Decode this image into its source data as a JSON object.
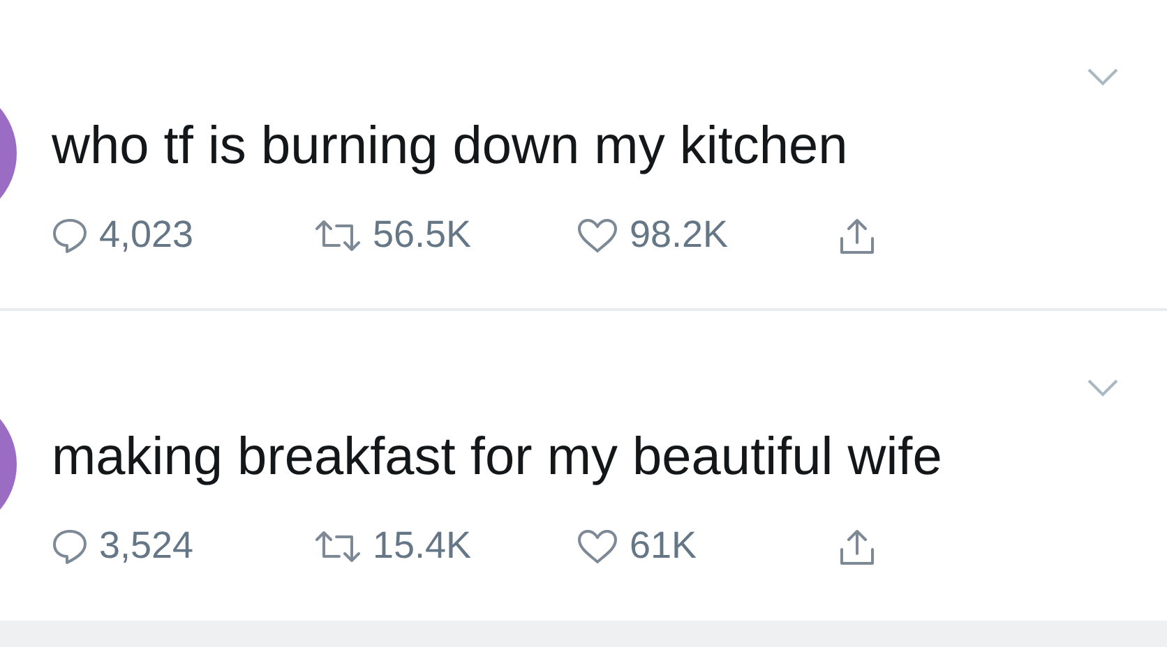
{
  "tweets": [
    {
      "text": "who tf is burning down my kitchen",
      "replies": "4,023",
      "retweets": "56.5K",
      "likes": "98.2K"
    },
    {
      "text": "making breakfast for my beautiful wife",
      "replies": "3,524",
      "retweets": "15.4K",
      "likes": "61K"
    }
  ]
}
